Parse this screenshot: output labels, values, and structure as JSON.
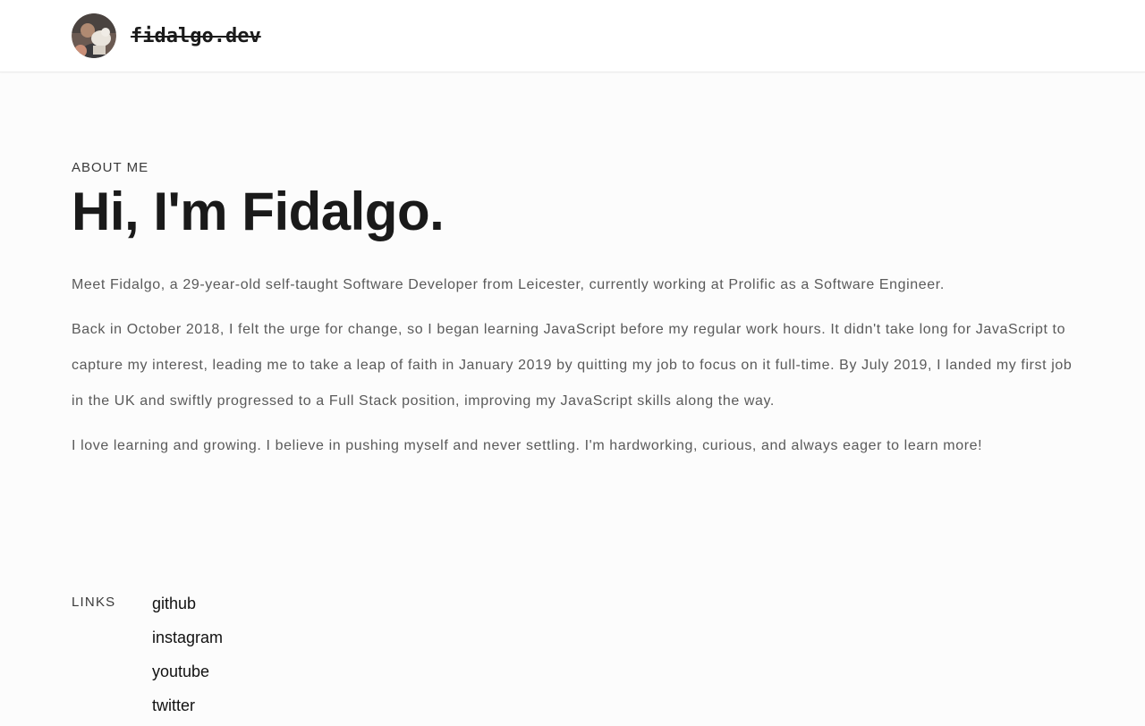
{
  "header": {
    "site_name": "fidalgo.dev",
    "avatar_icon": "person-photo-icon"
  },
  "about": {
    "eyebrow": "ABOUT ME",
    "title": "Hi, I'm Fidalgo.",
    "paragraphs": [
      "Meet Fidalgo, a 29-year-old self-taught Software Developer from Leicester, currently working at Prolific as a Software Engineer.",
      "Back in October 2018, I felt the urge for change, so I began learning JavaScript before my regular work hours. It didn't take long for JavaScript to capture my interest, leading me to take a leap of faith in January 2019 by quitting my job to focus on it full-time. By July 2019, I landed my first job in the UK and swiftly progressed to a Full Stack position, improving my JavaScript skills along the way.",
      "I love learning and growing. I believe in pushing myself and never settling. I'm hardworking, curious, and always eager to learn more!"
    ]
  },
  "links": {
    "label": "LINKS",
    "items": [
      {
        "label": "github"
      },
      {
        "label": "instagram"
      },
      {
        "label": "youtube"
      },
      {
        "label": "twitter"
      }
    ]
  },
  "colors": {
    "background": "#fcfcfc",
    "header_background": "#ffffff",
    "text_primary": "#1a1a1a",
    "text_secondary": "#5a5a5a"
  }
}
